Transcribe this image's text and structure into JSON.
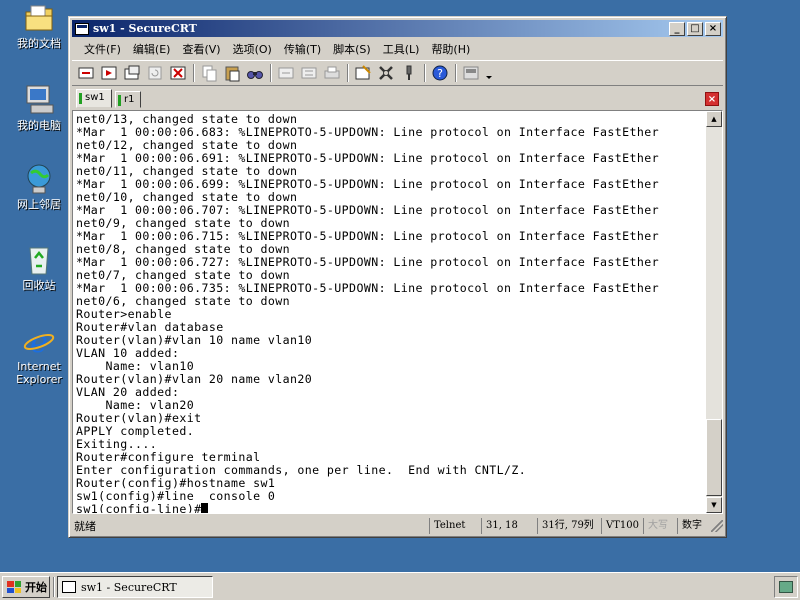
{
  "desktop": {
    "icons": [
      {
        "label": "我的文档",
        "icon": "my-documents-icon"
      },
      {
        "label": "我的电脑",
        "icon": "my-computer-icon"
      },
      {
        "label": "网上邻居",
        "icon": "network-places-icon"
      },
      {
        "label": "回收站",
        "icon": "recycle-bin-icon"
      },
      {
        "label": "Internet Explorer",
        "icon": "internet-explorer-icon"
      }
    ]
  },
  "window": {
    "title": "sw1 - SecureCRT",
    "controls": {
      "minimize": "_",
      "maximize": "□",
      "close": "×"
    },
    "menu": [
      "文件(F)",
      "编辑(E)",
      "查看(V)",
      "选项(O)",
      "传输(T)",
      "脚本(S)",
      "工具(L)",
      "帮助(H)"
    ],
    "tabs": [
      {
        "label": "sw1",
        "active": true
      },
      {
        "label": "r1",
        "active": false
      }
    ],
    "tab_close": "×",
    "terminal_lines": [
      "net0/13, changed state to down",
      "*Mar  1 00:00:06.683: %LINEPROTO-5-UPDOWN: Line protocol on Interface FastEther",
      "net0/12, changed state to down",
      "*Mar  1 00:00:06.691: %LINEPROTO-5-UPDOWN: Line protocol on Interface FastEther",
      "net0/11, changed state to down",
      "*Mar  1 00:00:06.699: %LINEPROTO-5-UPDOWN: Line protocol on Interface FastEther",
      "net0/10, changed state to down",
      "*Mar  1 00:00:06.707: %LINEPROTO-5-UPDOWN: Line protocol on Interface FastEther",
      "net0/9, changed state to down",
      "*Mar  1 00:00:06.715: %LINEPROTO-5-UPDOWN: Line protocol on Interface FastEther",
      "net0/8, changed state to down",
      "*Mar  1 00:00:06.727: %LINEPROTO-5-UPDOWN: Line protocol on Interface FastEther",
      "net0/7, changed state to down",
      "*Mar  1 00:00:06.735: %LINEPROTO-5-UPDOWN: Line protocol on Interface FastEther",
      "net0/6, changed state to down",
      "Router>enable",
      "Router#vlan database",
      "Router(vlan)#vlan 10 name vlan10",
      "VLAN 10 added:",
      "    Name: vlan10",
      "Router(vlan)#vlan 20 name vlan20",
      "VLAN 20 added:",
      "    Name: vlan20",
      "Router(vlan)#exit",
      "APPLY completed.",
      "Exiting....",
      "Router#configure terminal",
      "Enter configuration commands, one per line.  End with CNTL/Z.",
      "Router(config)#hostname sw1",
      "sw1(config)#line  console 0",
      "sw1(config-line)#"
    ],
    "status": {
      "ready": "就绪",
      "protocol": "Telnet",
      "cursor_pos": "31,  18",
      "row_col": "31行, 79列",
      "emulation": "VT100",
      "caps": "大写",
      "num": "数字"
    }
  },
  "taskbar": {
    "start_label": "开始",
    "task_label": "sw1 - SecureCRT"
  },
  "colors": {
    "desktop": "#3a6ea5",
    "titlebar_start": "#0a246a",
    "titlebar_end": "#a6caf0",
    "chrome": "#d4d0c8",
    "tab_close": "#d43030"
  }
}
